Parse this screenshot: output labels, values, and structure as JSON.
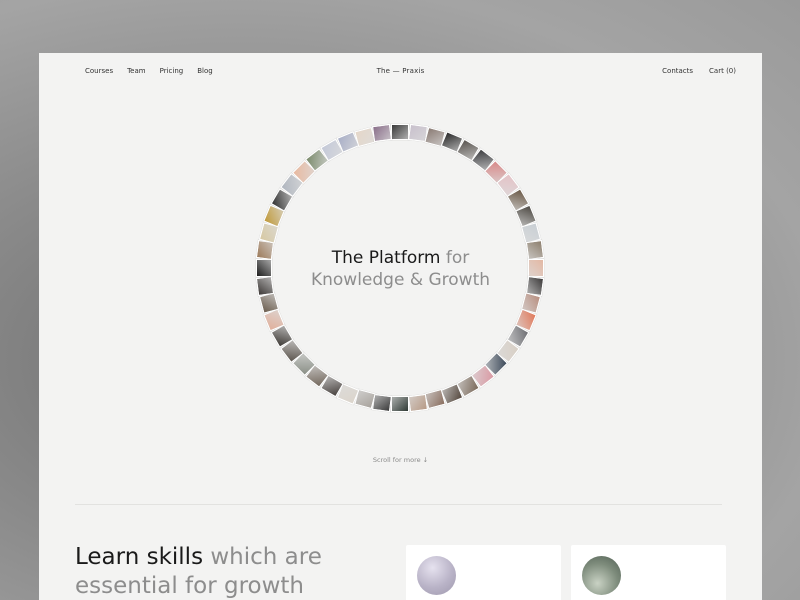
{
  "nav": {
    "left": [
      "Courses",
      "Team",
      "Pricing",
      "Blog"
    ],
    "brand": "The — Praxis",
    "contacts": "Contacts",
    "cart": "Cart (0)"
  },
  "hero": {
    "title_main": "The Platform",
    "title_for": " for",
    "title_line2": "Knowledge & Growth"
  },
  "scroll_hint": "Scroll for more  ↓",
  "learn": {
    "main": "Learn skills",
    "rest": " which are",
    "line2": "essential for growth"
  },
  "ring_thumbnails": [
    "#3a3a3a",
    "#c8c0cc",
    "#8b7c75",
    "#2b2b2b",
    "#5a5550",
    "#3e3f42",
    "#d88a8a",
    "#e4c2c6",
    "#6b5a48",
    "#4e4a44",
    "#c9cfd4",
    "#8d7f6e",
    "#e3b8a4",
    "#3c3a3a",
    "#b88f80",
    "#e07a5c",
    "#6e6f74",
    "#d8cfc5",
    "#3d4a5a",
    "#d99aa4",
    "#7b6a5b",
    "#55483e",
    "#8a6f60",
    "#b79a86",
    "#2f3a35",
    "#3b3b3b",
    "#a8a39d",
    "#dcd5cc",
    "#48423f",
    "#73685d",
    "#8a8f86",
    "#5d564f",
    "#3f3b37",
    "#e0b09c",
    "#6b5d4e",
    "#3e3a38",
    "#1e1e1e",
    "#9c7a5a",
    "#d7c9a3",
    "#c09a3c",
    "#333",
    "#b0b6bf",
    "#e8b9a0",
    "#7b8b6c",
    "#c4c9d8",
    "#a9afc7",
    "#e5d7c9",
    "#8a6f8a"
  ]
}
